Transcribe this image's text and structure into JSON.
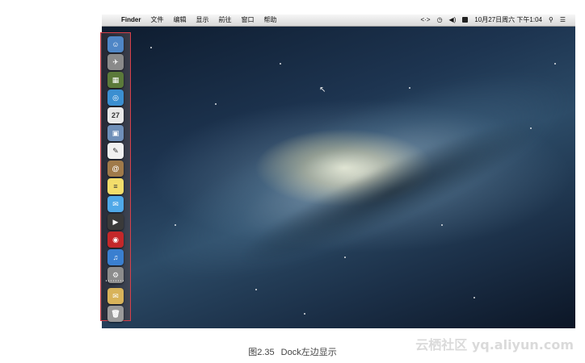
{
  "menubar": {
    "apple_glyph": "",
    "app_name": "Finder",
    "menus": [
      "文件",
      "编辑",
      "显示",
      "前往",
      "窗口",
      "帮助"
    ],
    "status": {
      "arrows": "<·>",
      "timemachine": "◷",
      "volume": "◀)",
      "datetime": "10月27日周六 下午1:04",
      "search_glyph": "⚲",
      "list_glyph": "☰"
    }
  },
  "dock": {
    "position": "left",
    "highlight_color": "#d9404a",
    "items": [
      {
        "name": "finder",
        "glyph": "☺",
        "color": "#4f86c6"
      },
      {
        "name": "launchpad",
        "glyph": "✈",
        "color": "#8a8a8a"
      },
      {
        "name": "mission-control",
        "glyph": "▦",
        "color": "#5b7a3a"
      },
      {
        "name": "safari",
        "glyph": "◎",
        "color": "#3b8fd1"
      },
      {
        "name": "calendar",
        "glyph": "27",
        "color": "#e9e9e9"
      },
      {
        "name": "preview",
        "glyph": "▣",
        "color": "#6f8fb8"
      },
      {
        "name": "text-edit",
        "glyph": "✎",
        "color": "#f0f0f0"
      },
      {
        "name": "contacts",
        "glyph": "@",
        "color": "#a07a4a"
      },
      {
        "name": "notes",
        "glyph": "≡",
        "color": "#f2dd6b"
      },
      {
        "name": "messages",
        "glyph": "✉",
        "color": "#4fa8e8"
      },
      {
        "name": "facetime",
        "glyph": "▶",
        "color": "#3a3a3a"
      },
      {
        "name": "photo-booth",
        "glyph": "◉",
        "color": "#c4282a"
      },
      {
        "name": "itunes",
        "glyph": "♫",
        "color": "#3a7fd0"
      },
      {
        "name": "system-preferences",
        "glyph": "⚙",
        "color": "#8c8c8c"
      },
      {
        "name": "downloads-stack",
        "glyph": "✉",
        "color": "#d8b35a"
      },
      {
        "name": "trash",
        "glyph": "🗑",
        "color": "#9a9a9a"
      }
    ]
  },
  "caption": {
    "number": "图2.35",
    "text": "Dock左边显示"
  },
  "watermark": "云栖社区 yq.aliyun.com"
}
